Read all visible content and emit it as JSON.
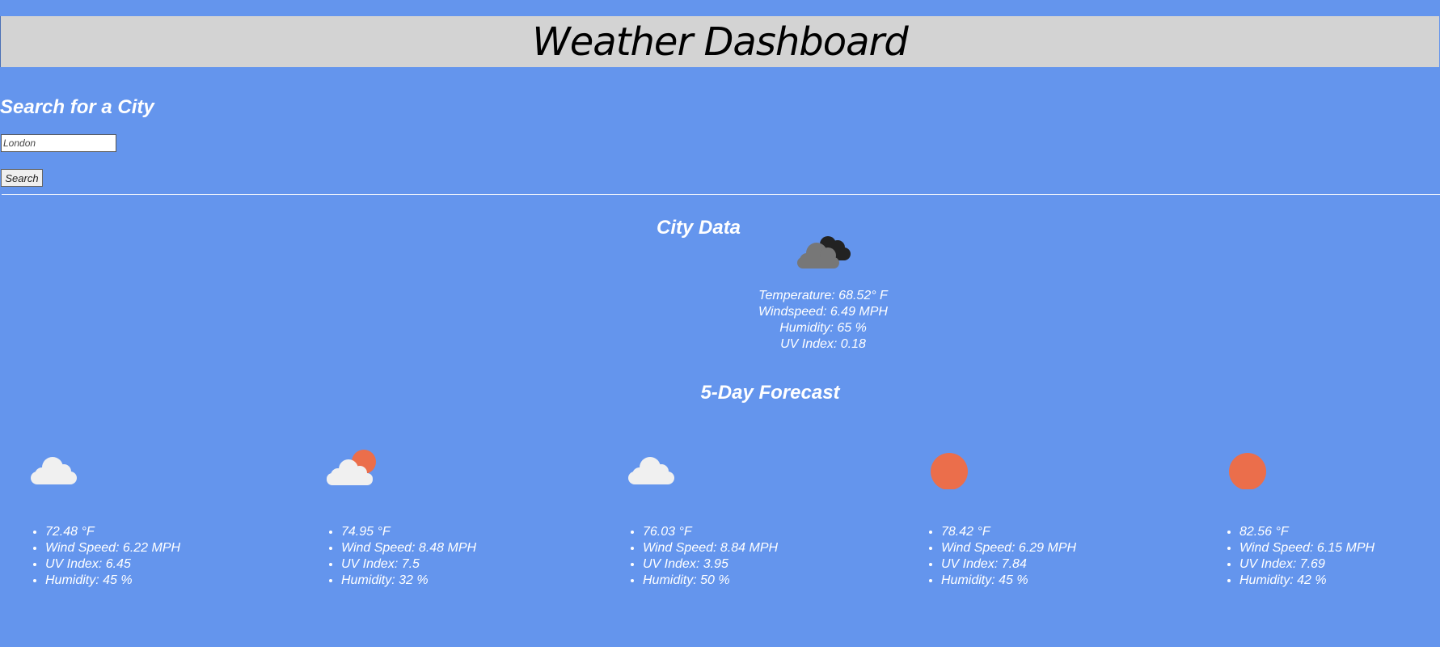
{
  "header": {
    "title": "Weather Dashboard"
  },
  "search": {
    "title": "Search for a City",
    "input_value": "London",
    "button_label": "Search"
  },
  "city": {
    "title": "City Data",
    "icon": "broken-clouds-icon",
    "temperature": "Temperature: 68.52° F",
    "windspeed": "Windspeed: 6.49 MPH",
    "humidity": "Humidity: 65 %",
    "uv_index": "UV Index: 0.18"
  },
  "forecast": {
    "title": "5-Day Forecast",
    "days": [
      {
        "icon": "cloud-icon",
        "temp": "72.48 °F",
        "wind": "Wind Speed: 6.22 MPH",
        "uv": "UV Index: 6.45",
        "humidity": "Humidity: 45 %"
      },
      {
        "icon": "partly-sunny-icon",
        "temp": "74.95 °F",
        "wind": "Wind Speed: 8.48 MPH",
        "uv": "UV Index: 7.5",
        "humidity": "Humidity: 32 %"
      },
      {
        "icon": "cloud-icon",
        "temp": "76.03 °F",
        "wind": "Wind Speed: 8.84 MPH",
        "uv": "UV Index: 3.95",
        "humidity": "Humidity: 50 %"
      },
      {
        "icon": "sun-icon",
        "temp": "78.42 °F",
        "wind": "Wind Speed: 6.29 MPH",
        "uv": "UV Index: 7.84",
        "humidity": "Humidity: 45 %"
      },
      {
        "icon": "sun-icon",
        "temp": "82.56 °F",
        "wind": "Wind Speed: 6.15 MPH",
        "uv": "UV Index: 7.69",
        "humidity": "Humidity: 42 %"
      }
    ]
  },
  "colors": {
    "background": "#6495ED",
    "header": "#D3D3D3",
    "sun": "#EB6E4B",
    "cloud_light": "#F0F0F0",
    "cloud_dark": "#6E6E6E"
  }
}
